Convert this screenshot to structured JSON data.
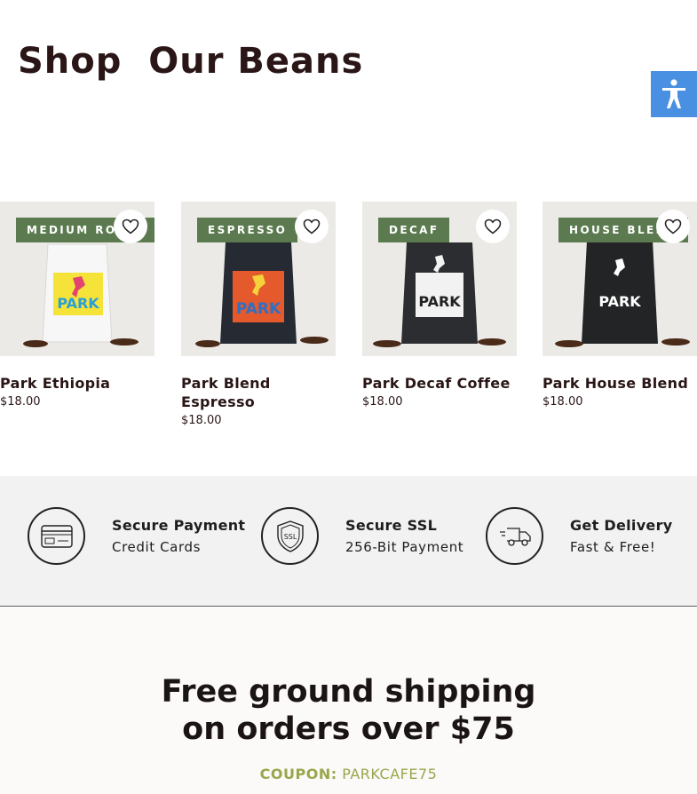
{
  "page": {
    "title": "Shop  Our Beans"
  },
  "accessibility": {
    "icon": "accessibility-icon",
    "color": "#4a90e2"
  },
  "products": [
    {
      "badge": "MEDIUM ROAST",
      "name": "Park Ethiopia",
      "price": "$18.00",
      "bag_color": "#f7f7f7",
      "label_color": "#f5e33a",
      "text_color": "#2a9fd6",
      "logo_text": "PARK"
    },
    {
      "badge": "ESPRESSO",
      "name": "Park Blend Espresso",
      "price": "$18.00",
      "bag_color": "#262a33",
      "label_color": "#e45a2c",
      "text_color": "#2f6fc4",
      "logo_text": "PARK"
    },
    {
      "badge": "DECAF",
      "name": "Park Decaf Coffee",
      "price": "$18.00",
      "bag_color": "#2b2d31",
      "label_color": "#f2f2f2",
      "text_color": "#222222",
      "logo_text": "PARK"
    },
    {
      "badge": "HOUSE BLEND",
      "name": "Park House Blend",
      "price": "$18.00",
      "bag_color": "#222426",
      "label_color": "#222426",
      "text_color": "#ffffff",
      "logo_text": "PARK"
    }
  ],
  "features": [
    {
      "title": "Secure Payment",
      "subtitle": "Credit Cards",
      "icon": "credit-card-icon"
    },
    {
      "title": "Secure SSL",
      "subtitle": "256-Bit Payment",
      "icon": "ssl-shield-icon"
    },
    {
      "title": "Get Delivery",
      "subtitle": "Fast & Free!",
      "icon": "delivery-truck-icon"
    }
  ],
  "promo": {
    "headline": "Free ground shipping on orders over $75",
    "coupon_label": "COUPON:",
    "coupon_code": "PARKCAFE75"
  },
  "colors": {
    "badge_bg": "#5b7a4f",
    "coupon": "#9aa64a",
    "title": "#2a1616"
  }
}
